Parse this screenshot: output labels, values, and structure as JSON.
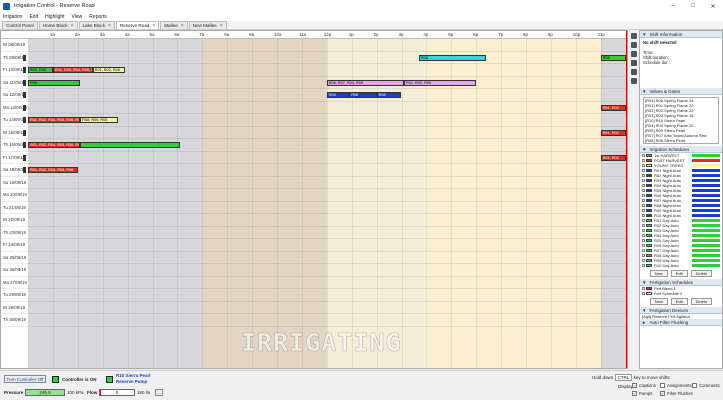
{
  "window": {
    "title": "Irrigation Control - Reserve Road"
  },
  "menu": [
    "Irrigation",
    "Edit",
    "Highlight",
    "View",
    "Reports"
  ],
  "tabs": [
    {
      "label": "Control Panel",
      "closable": false,
      "active": false
    },
    {
      "label": "Home Block",
      "closable": true,
      "active": false
    },
    {
      "label": "Lake Block",
      "closable": true,
      "active": false
    },
    {
      "label": "Reserve Road",
      "closable": true,
      "active": true
    },
    {
      "label": "Mallee",
      "closable": true,
      "active": false
    },
    {
      "label": "New Mallee",
      "closable": true,
      "active": false
    }
  ],
  "timeline": {
    "hours": [
      "1a",
      "2a",
      "3a",
      "4a",
      "5a",
      "6a",
      "7a",
      "8a",
      "9a",
      "10a",
      "11a",
      "12p",
      "1p",
      "2p",
      "3p",
      "4p",
      "5p",
      "6p",
      "7p",
      "8p",
      "9p",
      "10p",
      "11p"
    ],
    "rows": [
      {
        "label": "W 08/09/19"
      },
      {
        "label": "Th 09/09/19"
      },
      {
        "label": "Fr 10/09/19"
      },
      {
        "label": "Sa 11/09/19"
      },
      {
        "label": "Su 12/09/19"
      },
      {
        "label": "Mo 13/09/19"
      },
      {
        "label": "Tu 14/09/19"
      },
      {
        "label": "W 15/09/19"
      },
      {
        "label": "Th 16/09/19"
      },
      {
        "label": "Fr 17/09/19"
      },
      {
        "label": "Sa 18/09/19"
      },
      {
        "label": "Su 19/09/19"
      },
      {
        "label": "Mo 20/09/19"
      },
      {
        "label": "Tu 21/09/19"
      },
      {
        "label": "W 22/09/19"
      },
      {
        "label": "Th 23/09/19"
      },
      {
        "label": "Fr 24/09/19"
      },
      {
        "label": "Sa 25/09/19"
      },
      {
        "label": "Su 26/09/19"
      },
      {
        "label": "Mo 27/09/19"
      },
      {
        "label": "Tu 28/09/19"
      },
      {
        "label": "W 29/09/19"
      },
      {
        "label": "Th 30/09/19"
      }
    ],
    "blocks": [
      {
        "row": 1,
        "start": 15.7,
        "end": 18.4,
        "color": "cyan",
        "text": "R08"
      },
      {
        "row": 1,
        "start": 23.0,
        "end": 24.0,
        "color": "green",
        "text": "R08"
      },
      {
        "row": 2,
        "start": 0.0,
        "end": 1.0,
        "color": "green",
        "text": "R02, R03"
      },
      {
        "row": 2,
        "start": 1.0,
        "end": 2.6,
        "color": "red",
        "text": "R01, R03, R04, R05, R"
      },
      {
        "row": 2,
        "start": 2.6,
        "end": 3.9,
        "color": "yellow",
        "text": "R01, R02, R08"
      },
      {
        "row": 3,
        "start": 0.0,
        "end": 2.1,
        "color": "green",
        "text": "R09"
      },
      {
        "row": 3,
        "start": 12.0,
        "end": 15.1,
        "color": "pink",
        "text": "R08, R07, R04, R09"
      },
      {
        "row": 3,
        "start": 15.1,
        "end": 18.0,
        "color": "pink",
        "text": "R01, R02, R05"
      },
      {
        "row": 4,
        "start": 12.0,
        "end": 12.9,
        "color": "blue",
        "text": "R05"
      },
      {
        "row": 4,
        "start": 12.9,
        "end": 14.0,
        "color": "blue",
        "text": "R06"
      },
      {
        "row": 4,
        "start": 14.0,
        "end": 15.0,
        "color": "blue",
        "text": "R08"
      },
      {
        "row": 5,
        "start": 23.0,
        "end": 24.0,
        "color": "red",
        "text": "R01, R02"
      },
      {
        "row": 6,
        "start": 0.0,
        "end": 2.1,
        "color": "red",
        "text": "R01, R02, R04, R05, R06, R07"
      },
      {
        "row": 6,
        "start": 2.1,
        "end": 3.6,
        "color": "yellow",
        "text": "R08, R09, R05"
      },
      {
        "row": 7,
        "start": 23.0,
        "end": 24.0,
        "color": "red",
        "text": "R01, R02"
      },
      {
        "row": 8,
        "start": 0.0,
        "end": 2.1,
        "color": "red",
        "text": "R01, R02, R04, R05, R06, R07"
      },
      {
        "row": 8,
        "start": 2.1,
        "end": 6.1,
        "color": "green",
        "text": ""
      },
      {
        "row": 9,
        "start": 23.0,
        "end": 24.0,
        "color": "red",
        "text": "R01, R02"
      },
      {
        "row": 10,
        "start": 0.0,
        "end": 2.0,
        "color": "red",
        "text": "R01, R02, R04, R05, R06"
      }
    ],
    "watermark": "IRRIGATING"
  },
  "side": {
    "shift": {
      "title": "Shift Information",
      "status": "No shift selected",
      "lines": [
        "Time:",
        "Shift duration:",
        "Schedule dur.:"
      ]
    },
    "valves": {
      "title": "Valves & Gates",
      "items": [
        "[R04] R06 Spring Flame 24",
        "[R01] R01 Spring Flame 22",
        "[R02] R02 Spring Flame 22",
        "[R03] R03 Spring Flame 18",
        "[R10] R10 Sierra Pearl",
        "[R04] R04 Spring Flame 22",
        "[R05] R05 Sierra Pearl",
        "[R07] R07 Artic Snow/Autumn Red",
        "[R08] R08 Sierra Pearl"
      ]
    },
    "irrigation": {
      "title": "Irrigation Schedules",
      "items": [
        {
          "label": "1st HARVEST",
          "color": "#e86a1a",
          "bar": "#2fcf35"
        },
        {
          "label": "POST HARVEST",
          "color": "#d43322",
          "bar": "#d43322"
        },
        {
          "label": "YOUNG TREES",
          "color": "#f5f39e",
          "bar": "#f5f39e"
        },
        {
          "label": "R01 Night Auto",
          "color": "#1a3fcf",
          "bar": "#1a3fcf"
        },
        {
          "label": "R02 Night Auto",
          "color": "#1a3fcf",
          "bar": "#1a3fcf"
        },
        {
          "label": "R03 Night Auto",
          "color": "#1a3fcf",
          "bar": "#1a3fcf"
        },
        {
          "label": "R04 Night Auto",
          "color": "#1a3fcf",
          "bar": "#1a3fcf"
        },
        {
          "label": "R05 Night Auto",
          "color": "#1a3fcf",
          "bar": "#1a3fcf"
        },
        {
          "label": "R06 Night Auto",
          "color": "#1a3fcf",
          "bar": "#1a3fcf"
        },
        {
          "label": "R07 Night Auto",
          "color": "#1a3fcf",
          "bar": "#1a3fcf"
        },
        {
          "label": "R08 Night Auto",
          "color": "#1a3fcf",
          "bar": "#1a3fcf"
        },
        {
          "label": "R09 Night Auto",
          "color": "#1a3fcf",
          "bar": "#1a3fcf"
        },
        {
          "label": "R10 Night Auto",
          "color": "#1a3fcf",
          "bar": "#1a3fcf"
        },
        {
          "label": "R01 Day Auto",
          "color": "#2fcf35",
          "bar": "#2fcf35"
        },
        {
          "label": "R02 Day Auto",
          "color": "#2fcf35",
          "bar": "#2fcf35"
        },
        {
          "label": "R03 Day Auto",
          "color": "#2fcf35",
          "bar": "#2fcf35"
        },
        {
          "label": "R04 Day Auto",
          "color": "#2fcf35",
          "bar": "#2fcf35"
        },
        {
          "label": "R05 Day Auto",
          "color": "#2fcf35",
          "bar": "#2fcf35"
        },
        {
          "label": "R06 Day Auto",
          "color": "#2fcf35",
          "bar": "#2fcf35"
        },
        {
          "label": "R07 Day Auto",
          "color": "#2fcf35",
          "bar": "#2fcf35"
        },
        {
          "label": "R08 Day Auto",
          "color": "#2fcf35",
          "bar": "#2fcf35"
        },
        {
          "label": "R09 Day Auto",
          "color": "#2fcf35",
          "bar": "#2fcf35"
        },
        {
          "label": "R10 Day Auto",
          "color": "#2fcf35",
          "bar": "#2fcf35"
        }
      ],
      "buttons": [
        "New",
        "Edit",
        "Delete"
      ]
    },
    "fertigation": {
      "title": "Fertigation Schedules",
      "items": [
        {
          "label": "Fert Blend 1",
          "color": "#c03a3a"
        },
        {
          "label": "Fert Schedule 2",
          "color": "#ffffff"
        }
      ],
      "buttons": [
        "New",
        "Edit",
        "Delete"
      ]
    },
    "devices": {
      "title": "Fertigation Devices",
      "items": [
        "[Agit] Reserve Fert Agitator"
      ]
    },
    "flush": {
      "title": "Auto Filter Flushing"
    }
  },
  "status": {
    "controller_button": "Turn Controller Off",
    "controller_state": "Controller is ON",
    "pump_line1": "R10 Sierra Pearl",
    "pump_line2": "Reserve Pump",
    "pressure_label": "Pressure",
    "pressure_value": "245.5",
    "pressure_unit": "100 kPa",
    "flow_label": "Flow",
    "flow_value": "0",
    "flow_unit": "180 l/s",
    "hint_a": "Hold down",
    "hint_key": "CTRL",
    "hint_b": "key to move shifts",
    "display_label": "Display:",
    "checks": [
      {
        "label": "Captions",
        "checked": true
      },
      {
        "label": "Assignments",
        "checked": false
      },
      {
        "label": "Comments",
        "checked": false
      },
      {
        "label": "Pumps",
        "checked": true
      },
      {
        "label": "Filter Flushes",
        "checked": true
      }
    ]
  }
}
